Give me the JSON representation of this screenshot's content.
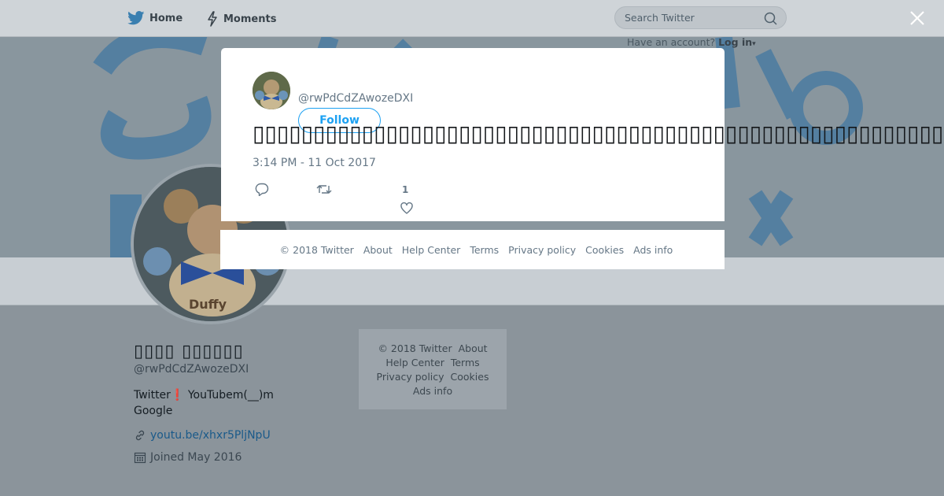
{
  "nav": {
    "home_label": "Home",
    "moments_label": "Moments",
    "search_placeholder": "Search Twitter",
    "account_prompt": "Have an account?",
    "login_label": "Log in"
  },
  "profile": {
    "name": "▯▯▯▯ ▯▯▯▯▯▯",
    "handle": "@rwPdCdZAwozeDXI",
    "bio_prefix": "Twitter",
    "bio_emoji": "❗",
    "bio_suffix": "YouTubem(__)m Google",
    "link": "youtu.be/xhxr5PljNpU",
    "joined": "Joined May 2016"
  },
  "side_footer": {
    "copyright": "© 2018 Twitter",
    "about": "About",
    "help": "Help Center",
    "terms": "Terms",
    "privacy": "Privacy policy",
    "cookies": "Cookies",
    "ads": "Ads info"
  },
  "tweet": {
    "handle": "@rwPdCdZAwozeDXI",
    "follow_label": "Follow",
    "text": "▯▯▯▯▯▯▯▯▯▯▯▯▯▯▯▯▯▯▯▯▯▯▯▯▯▯▯▯▯▯▯▯▯▯▯▯▯▯▯▯▯▯▯▯▯▯▯▯▯▯▯▯▯▯▯▯▯",
    "timestamp": "3:14 PM - 11 Oct 2017",
    "like_count": "1"
  },
  "modal_footer": {
    "copyright": "© 2018 Twitter",
    "about": "About",
    "help": "Help Center",
    "terms": "Terms",
    "privacy": "Privacy policy",
    "cookies": "Cookies",
    "ads": "Ads info"
  },
  "colors": {
    "brand": "#1da1f2",
    "overlay_page": "#8b949b"
  },
  "icons": [
    "twitter-bird-icon",
    "lightning-icon",
    "search-icon",
    "close-icon",
    "reply-icon",
    "retweet-icon",
    "heart-icon",
    "link-icon",
    "calendar-icon"
  ]
}
